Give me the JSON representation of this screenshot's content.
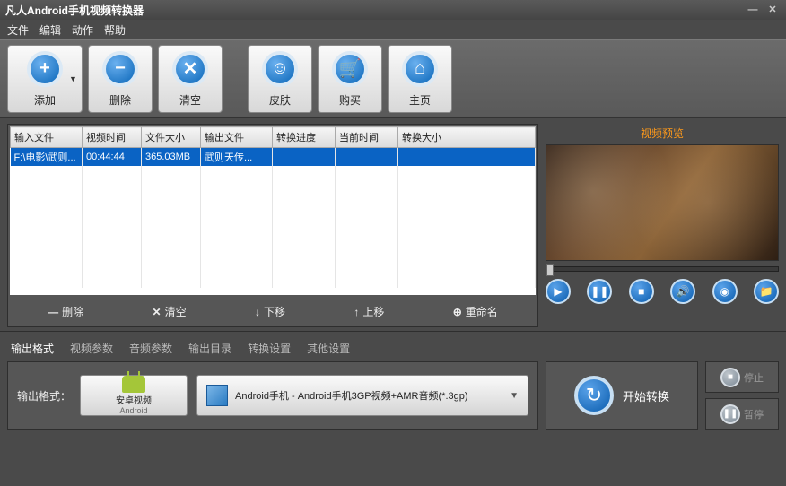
{
  "window": {
    "title": "凡人Android手机视频转换器"
  },
  "menu": {
    "file": "文件",
    "edit": "编辑",
    "action": "动作",
    "help": "帮助"
  },
  "toolbar": {
    "add": "添加",
    "delete": "删除",
    "clear": "清空",
    "skin": "皮肤",
    "buy": "购买",
    "home": "主页"
  },
  "table": {
    "headers": {
      "input": "输入文件",
      "duration": "视频时间",
      "size": "文件大小",
      "output": "输出文件",
      "progress": "转换进度",
      "curtime": "当前时间",
      "outsize": "转换大小"
    },
    "rows": [
      {
        "input": "F:\\电影\\武则...",
        "duration": "00:44:44",
        "size": "365.03MB",
        "output": "武则天传...",
        "progress": "",
        "curtime": "",
        "outsize": ""
      }
    ]
  },
  "listActions": {
    "delete": "删除",
    "clear": "清空",
    "down": "下移",
    "up": "上移",
    "rename": "重命名"
  },
  "preview": {
    "title": "视频预览",
    "icons": {
      "play": "play",
      "pause": "pause",
      "stop": "stop",
      "volume": "volume",
      "snapshot": "snapshot",
      "open": "open"
    }
  },
  "tabs": {
    "outputFormat": "输出格式",
    "videoParams": "视频参数",
    "audioParams": "音频参数",
    "outputDir": "输出目录",
    "convertSettings": "转换设置",
    "otherSettings": "其他设置"
  },
  "output": {
    "label": "输出格式：",
    "category": "安卓视频",
    "categorySub": "Android",
    "format": "Android手机 - Android手机3GP视频+AMR音频(*.3gp)"
  },
  "actions": {
    "start": "开始转换",
    "stop": "停止",
    "pause": "暂停"
  }
}
